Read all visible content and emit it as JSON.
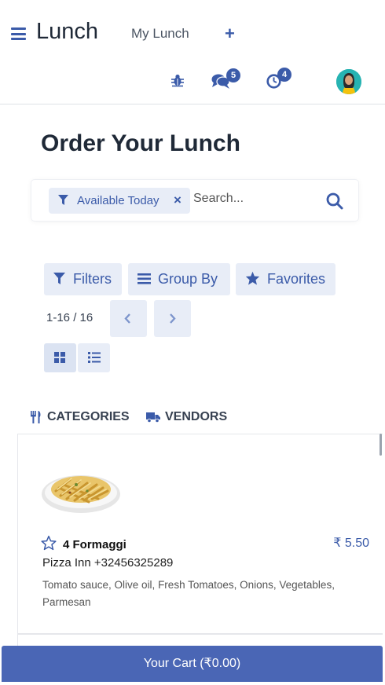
{
  "header": {
    "app_title": "Lunch",
    "menu_item": "My Lunch",
    "new_label": "+",
    "messages_count": "5",
    "activities_count": "4"
  },
  "page": {
    "title": "Order Your Lunch"
  },
  "search": {
    "facet_label": "Available Today",
    "placeholder": "Search..."
  },
  "toolbar": {
    "filters": "Filters",
    "group_by": "Group By",
    "favorites": "Favorites"
  },
  "pager": {
    "value": "1-16 / 16"
  },
  "searchpanel": {
    "categories": "CATEGORIES",
    "vendors": "VENDORS"
  },
  "products": [
    {
      "name": "4 Formaggi",
      "price": "₹ 5.50",
      "vendor": "Pizza Inn +32456325289",
      "description": "Tomato sauce, Olive oil, Fresh Tomatoes, Onions, Vegetables, Parmesan"
    }
  ],
  "cart": {
    "label": "Your Cart (₹0.00)"
  },
  "colors": {
    "accent": "#3b5ba9",
    "button_bg": "#e8edf7",
    "cart_bar": "#4a66b5"
  }
}
